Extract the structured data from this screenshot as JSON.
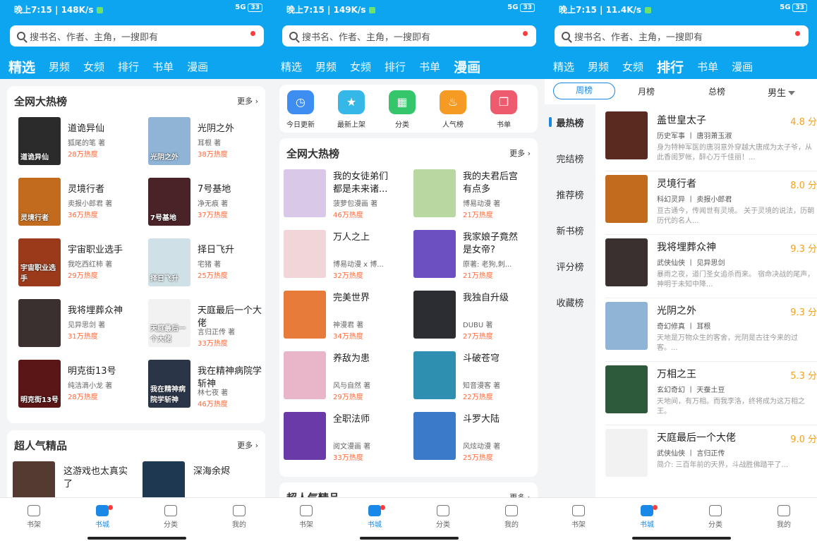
{
  "screens": [
    {
      "status": {
        "time": "晚上7:15 | 148K/s",
        "right": "5G",
        "battery": "33"
      },
      "search_placeholder": "搜书名、作者、主角，一搜即有",
      "tabs": [
        "精选",
        "男频",
        "女频",
        "排行",
        "书单",
        "漫画"
      ],
      "active_tab": 0,
      "section1": {
        "title": "全网大热榜",
        "more": "更多",
        "books": [
          {
            "name": "道诡异仙",
            "author": "狐尾的笔 著",
            "heat": "28万热度",
            "cover_text": "道诡异仙",
            "color": "#2b2b2b"
          },
          {
            "name": "光阴之外",
            "author": "耳根 著",
            "heat": "38万热度",
            "cover_text": "光阴之外",
            "color": "#8fb4d6"
          },
          {
            "name": "灵境行者",
            "author": "卖报小郎君 著",
            "heat": "36万热度",
            "cover_text": "灵境行者",
            "color": "#c26a1e"
          },
          {
            "name": "7号基地",
            "author": "净无痕 著",
            "heat": "37万热度",
            "cover_text": "7号基地",
            "color": "#4a2328"
          },
          {
            "name": "宇宙职业选手",
            "author": "我吃西红柿 著",
            "heat": "29万热度",
            "cover_text": "宇宙职业选手",
            "color": "#9b3a1a"
          },
          {
            "name": "择日飞升",
            "author": "宅猪 著",
            "heat": "25万热度",
            "cover_text": "择日飞升",
            "color": "#cfe0e6"
          },
          {
            "name": "我将埋葬众神",
            "author": "见异思剑 著",
            "heat": "31万热度",
            "cover_text": "",
            "color": "#3a3030"
          },
          {
            "name": "天庭最后一个大佬",
            "author": "言归正传 著",
            "heat": "33万热度",
            "cover_text": "天庭最后一个大佬",
            "color": "#f2f2f2"
          },
          {
            "name": "明克街13号",
            "author": "纯洁滴小龙 著",
            "heat": "28万热度",
            "cover_text": "明克街13号",
            "color": "#5a1616"
          },
          {
            "name": "我在精神病院学斩神",
            "author": "林七夜 著",
            "heat": "46万热度",
            "cover_text": "我在精神病院学斩神",
            "color": "#2a3548"
          }
        ]
      },
      "section2": {
        "title": "超人气精品",
        "more": "更多",
        "books": [
          {
            "name": "这游戏也太真实了",
            "color": "#553a32"
          },
          {
            "name": "深海余烬",
            "color": "#1d3850"
          }
        ]
      },
      "nav": [
        "书架",
        "书城",
        "分类",
        "我的"
      ],
      "nav_active": 1
    },
    {
      "status": {
        "time": "晚上7:15 | 149K/s",
        "right": "5G",
        "battery": "33"
      },
      "search_placeholder": "搜书名、作者、主角，一搜即有",
      "tabs": [
        "精选",
        "男频",
        "女频",
        "排行",
        "书单",
        "漫画"
      ],
      "active_tab": 5,
      "icons": [
        {
          "label": "今日更新",
          "icon": "clock-icon",
          "glyph": "◷",
          "color": "#3d8ef0"
        },
        {
          "label": "最新上架",
          "icon": "star-box-icon",
          "glyph": "★",
          "color": "#35b7e8"
        },
        {
          "label": "分类",
          "icon": "grid-icon",
          "glyph": "▦",
          "color": "#35c56a"
        },
        {
          "label": "人气榜",
          "icon": "flame-icon",
          "glyph": "♨",
          "color": "#f59a23"
        },
        {
          "label": "书单",
          "icon": "book-icon",
          "glyph": "❐",
          "color": "#ee5a6e"
        }
      ],
      "section1": {
        "title": "全网大热榜",
        "more": "更多",
        "books": [
          {
            "name": "我的女徒弟们都是未来诸...",
            "author": "菠萝包漫画 著",
            "heat": "46万热度",
            "color": "#d9c8e8"
          },
          {
            "name": "我的夫君后宫有点多",
            "author": "博易动漫 著",
            "heat": "21万热度",
            "color": "#b9d7a0"
          },
          {
            "name": "万人之上",
            "author": "博易动漫 x 博...",
            "heat": "32万热度",
            "color": "#f2d5d8"
          },
          {
            "name": "我家娘子竟然是女帝?",
            "author": "原著: 老狗,刺...",
            "heat": "21万热度",
            "color": "#6c4fc0"
          },
          {
            "name": "完美世界",
            "author": "神漫君 著",
            "heat": "34万热度",
            "color": "#e67b3a"
          },
          {
            "name": "我独自升级",
            "author": "DUBU 著",
            "heat": "27万热度",
            "color": "#2c2c33"
          },
          {
            "name": "养敌为患",
            "author": "风与自然 著",
            "heat": "29万热度",
            "color": "#e8b6c8"
          },
          {
            "name": "斗破苍穹",
            "author": "知音漫客 著",
            "heat": "22万热度",
            "color": "#2f8fb0"
          },
          {
            "name": "全职法师",
            "author": "阅文漫画 著",
            "heat": "33万热度",
            "color": "#6a3aa8"
          },
          {
            "name": "斗罗大陆",
            "author": "风炫动漫 著",
            "heat": "25万热度",
            "color": "#3a7ac8"
          }
        ]
      },
      "section2": {
        "title": "超人气精品",
        "more": "更多"
      },
      "nav": [
        "书架",
        "书城",
        "分类",
        "我的"
      ],
      "nav_active": 1
    },
    {
      "status": {
        "time": "晚上7:15 | 11.4K/s",
        "right": "5G",
        "battery": "33"
      },
      "search_placeholder": "搜书名、作者、主角，一搜即有",
      "tabs": [
        "精选",
        "男频",
        "女频",
        "排行",
        "书单",
        "漫画"
      ],
      "active_tab": 3,
      "subtabs": [
        "周榜",
        "月榜",
        "总榜"
      ],
      "gender": "男生",
      "side": [
        "最热榜",
        "完结榜",
        "推荐榜",
        "新书榜",
        "评分榜",
        "收藏榜"
      ],
      "ranks": [
        {
          "name": "盖世皇太子",
          "score": "4.8 分",
          "cat": "历史军事 丨 唐羽萧玉淑",
          "desc": "身为特种军医的唐羽意外穿越大唐成为太子爷，从此香闺罗帐，醉心万千佳丽！...",
          "color": "#5a2a20"
        },
        {
          "name": "灵境行者",
          "score": "8.0 分",
          "cat": "科幻灵异 丨 卖报小郎君",
          "desc": "亘古通今，传闻世有灵境。 关于灵境的说法，历朝历代的名人...",
          "color": "#c26a1e"
        },
        {
          "name": "我将埋葬众神",
          "score": "9.3 分",
          "cat": "武侠仙侠 丨 见异思剑",
          "desc": "暴雨之夜，道门圣女追杀而来。 宿命决战的尾声，神明于未知中降...",
          "color": "#3a3030"
        },
        {
          "name": "光阴之外",
          "score": "9.3 分",
          "cat": "奇幻修真 丨 耳根",
          "desc": "天地是万物众生的客舍，光阴是古往今来的过客。...",
          "color": "#8fb4d6"
        },
        {
          "name": "万相之王",
          "score": "5.3 分",
          "cat": "玄幻奇幻 丨 天蚕土豆",
          "desc": "天地间，有万相。而我李洛，终将成为这万相之王。",
          "color": "#2c5a3a"
        },
        {
          "name": "天庭最后一个大佬",
          "score": "9.0 分",
          "cat": "武侠仙侠 丨 言归正传",
          "desc": "简介: 三百年前的天界，斗战胜佛踏平了...",
          "color": "#f2f2f2"
        }
      ],
      "nav": [
        "书架",
        "书城",
        "分类",
        "我的"
      ],
      "nav_active": 1
    }
  ]
}
